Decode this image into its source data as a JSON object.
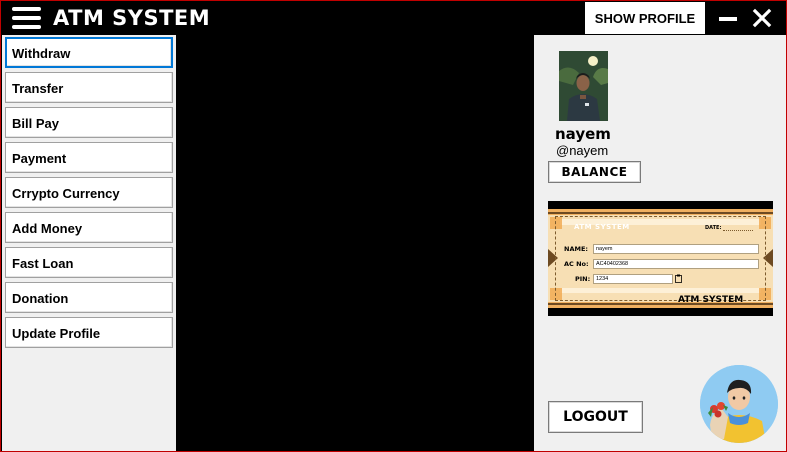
{
  "app": {
    "title": "ATM SYSTEM",
    "show_profile_label": "SHOW PROFILE",
    "accent_color": "#0078d7",
    "border_color": "#c00000"
  },
  "sidebar": {
    "items": [
      {
        "label": "Withdraw",
        "active": true
      },
      {
        "label": "Transfer"
      },
      {
        "label": "Bill Pay"
      },
      {
        "label": "Payment"
      },
      {
        "label": "Crrypto Currency"
      },
      {
        "label": "Add Money"
      },
      {
        "label": "Fast Loan"
      },
      {
        "label": "Donation"
      },
      {
        "label": "Update Profile"
      }
    ]
  },
  "profile": {
    "name": "nayem",
    "handle": "@nayem",
    "balance_label": "BALANCE",
    "logout_label": "LOGOUT"
  },
  "card": {
    "title": "ATM SYSTEM",
    "date_label": "DATE:",
    "name_label": "NAME:",
    "name_value": "nayem",
    "ac_label": "AC No:",
    "ac_value": "AC40402368",
    "pin_label": "PIN:",
    "pin_value": "1234",
    "brand": "ATM SYSTEM"
  },
  "icons": {
    "menu": "hamburger-icon",
    "minimize": "minimize-icon",
    "close": "close-icon",
    "copy": "clipboard-icon",
    "assistant": "assistant-avatar"
  }
}
